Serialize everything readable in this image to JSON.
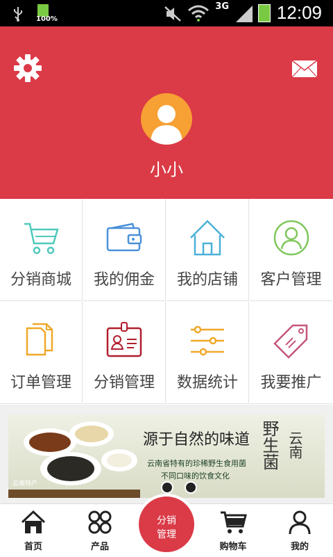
{
  "status_bar": {
    "battery_percent": "100%",
    "network": "3G",
    "time": "12:09"
  },
  "header": {
    "username": "小小",
    "settings_icon": "gear-icon",
    "message_icon": "envelope-icon",
    "avatar_icon": "user-avatar-icon",
    "background": "#db3a47"
  },
  "grid": [
    {
      "label": "分销商城",
      "icon": "cart-icon",
      "color": "#4fc9bb"
    },
    {
      "label": "我的佣金",
      "icon": "wallet-icon",
      "color": "#4a90d9"
    },
    {
      "label": "我的店铺",
      "icon": "house-icon",
      "color": "#4bb0d8"
    },
    {
      "label": "客户管理",
      "icon": "user-circle-icon",
      "color": "#7ec75a"
    },
    {
      "label": "订单管理",
      "icon": "documents-icon",
      "color": "#f0a829"
    },
    {
      "label": "分销管理",
      "icon": "id-badge-icon",
      "color": "#b11d2c"
    },
    {
      "label": "数据统计",
      "icon": "sliders-icon",
      "color": "#f0a829"
    },
    {
      "label": "我要推广",
      "icon": "tag-icon",
      "color": "#c5557a"
    }
  ],
  "banner": {
    "title": "源于自然的味道",
    "subtitle1": "云南省特有的珍稀野生食用菌",
    "subtitle2": "不同口味的饮食文化",
    "side_text1": "野生菌",
    "side_text2": "云南",
    "logo_text": "云南特产"
  },
  "bottom_nav": {
    "home": "首页",
    "products": "产品",
    "center_line1": "分销",
    "center_line2": "管理",
    "cart": "购物车",
    "mine": "我的"
  }
}
